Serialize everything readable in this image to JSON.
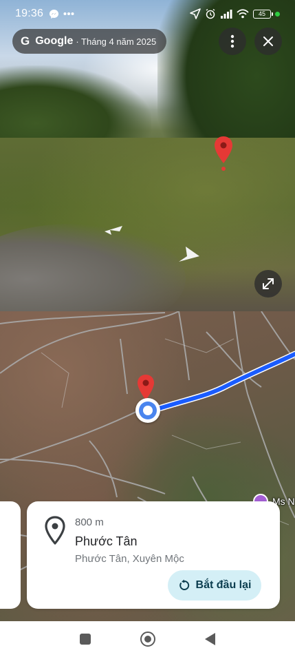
{
  "status_bar": {
    "time": "19:36",
    "battery_level": "45",
    "icons": [
      "messenger-icon",
      "more-dots-icon",
      "location-arrow-icon",
      "alarm-icon",
      "signal-icon",
      "wifi-icon",
      "battery-icon"
    ]
  },
  "street_view": {
    "source_logo": "G",
    "source_name": "Google",
    "capture_date": "· Tháng 4 năm 2025",
    "icons": [
      "more-vertical-icon",
      "close-icon",
      "expand-icon",
      "nav-arrow-icon",
      "location-pin-icon"
    ]
  },
  "map": {
    "poi_label": "Ms N",
    "route_color": "#1a5cff",
    "pin_color": "#e53935"
  },
  "place_card": {
    "distance": "800 m",
    "name": "Phước Tân",
    "address": "Phước Tân, Xuyên Mộc",
    "restart_label": "Bắt đầu lại",
    "icons": [
      "place-pin-outline-icon",
      "restart-icon"
    ]
  },
  "nav_bar": {
    "icons": [
      "recents-icon",
      "home-icon",
      "back-icon"
    ]
  }
}
